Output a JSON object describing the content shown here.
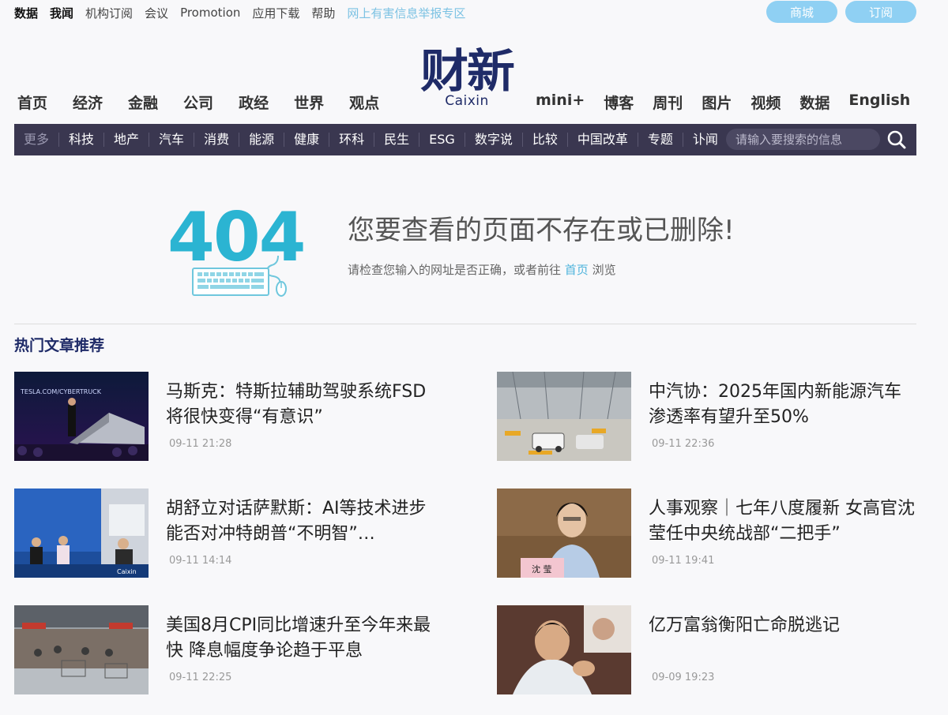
{
  "topbar": {
    "links": [
      "数据",
      "我闻",
      "机构订阅",
      "会议",
      "Promotion",
      "应用下载",
      "帮助"
    ],
    "report": "网上有害信息举报专区",
    "btn_shop": "商城",
    "btn_subscribe": "订阅"
  },
  "logo": {
    "cn": "财新",
    "en": "Caixin"
  },
  "mainnav": {
    "left": [
      "首页",
      "经济",
      "金融",
      "公司",
      "政经",
      "世界",
      "观点"
    ],
    "right": [
      "mini+",
      "博客",
      "周刊",
      "图片",
      "视频",
      "数据",
      "English"
    ]
  },
  "subnav": {
    "more": "更多",
    "items": [
      "科技",
      "地产",
      "汽车",
      "消费",
      "能源",
      "健康",
      "环科",
      "民生",
      "ESG",
      "数字说",
      "比较",
      "中国改革",
      "专题",
      "讣闻"
    ],
    "search_placeholder": "请输入要搜索的信息"
  },
  "error": {
    "code": "404",
    "title": "您要查看的页面不存在或已删除!",
    "desc_before": "请检查您输入的网址是否正确，或者前往 ",
    "desc_link": "首页",
    "desc_after": " 浏览"
  },
  "section_title": "热门文章推荐",
  "articles": [
    {
      "title": "马斯克：特斯拉辅助驾驶系统FSD将很快变得“有意识”",
      "time": "09-11 21:28",
      "thumb_text": "TESLA.COM/CYBERTRUCK"
    },
    {
      "title": "中汽协：2025年国内新能源汽车渗透率有望升至50%",
      "time": "09-11 22:36"
    },
    {
      "title": "胡舒立对话萨默斯：AI等技术进步能否对冲特朗普“不明智”…",
      "time": "09-11 14:14",
      "thumb_text": "Caixin"
    },
    {
      "title": "人事观察｜七年八度履新 女高官沈莹任中央统战部“二把手”",
      "time": "09-11 19:41",
      "thumb_text": "沈 莹"
    },
    {
      "title": "美国8月CPI同比增速升至今年来最快 降息幅度争论趋于平息",
      "time": "09-11 22:25"
    },
    {
      "title": "亿万富翁衡阳亡命脱逃记",
      "time": "09-09 19:23"
    }
  ]
}
